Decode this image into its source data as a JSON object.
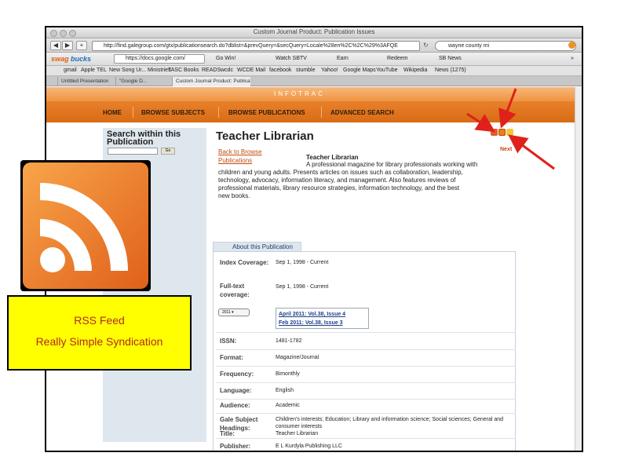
{
  "window": {
    "title": "Custom Journal Product: Publication Issues"
  },
  "toolbar": {
    "url": "http://find.galegroup.com/gtx/publicationsearch.do?dblist=&prevQuery=&secQuery=Locale%28en%2C%2C%29%3AFQE",
    "search_value": "wayne county mi"
  },
  "swagbar": {
    "logo_swag": "swag",
    "logo_bucks": "bucks",
    "search_value": "https://docs.google.com/",
    "items": [
      "Go Win!",
      "Watch SBTV",
      "Earn",
      "Redeem",
      "SB News"
    ],
    "overflow": "»"
  },
  "bookmarks": {
    "items": [
      "gmail",
      "Apple",
      "TEL",
      "New Song Ur... Ministries",
      "TASC",
      "Books",
      "READS",
      "wcdc",
      "WCDE Mail",
      "facebook",
      "stumble",
      "Yahoo!",
      "Google Maps",
      "YouTube",
      "Wikipedia",
      "News (1275)"
    ]
  },
  "tabs": {
    "items": [
      "Untitled Presentation",
      "\"Google D...",
      "Custom Journal Product: Publicati..."
    ]
  },
  "site": {
    "logo": "INFOTRAC",
    "nav": [
      "HOME",
      "BROWSE SUBJECTS",
      "BROWSE PUBLICATIONS",
      "ADVANCED SEARCH"
    ]
  },
  "sidebar": {
    "heading": "Search within this Publication",
    "go_label": "Go"
  },
  "publication": {
    "title": "Teacher Librarian",
    "back_link": "Back to Browse Publications",
    "next_label": "Next",
    "desc_title": "Teacher Librarian",
    "desc_lines": [
      "A professional magazine for library professionals working with",
      "children and young adults. Presents articles on issues such as collaboration, leadership,",
      "technology, advocacy, information literacy, and management. Also features reviews of",
      "professional materials, library resource strategies, information technology, and the best",
      "new books."
    ],
    "about_tab": "About this Publication",
    "year_select": "2011",
    "issues": [
      "April 2011: Vol.38, Issue 4",
      "Feb 2011: Vol.38, Issue 3"
    ],
    "fields": [
      {
        "label": "Index Coverage:",
        "value": "Sep 1, 1998 - Current"
      },
      {
        "label": "Full-text coverage:",
        "value": "Sep 1, 1998 - Current"
      },
      {
        "label": "ISSN:",
        "value": "1481-1782"
      },
      {
        "label": "Format:",
        "value": "Magazine/Journal"
      },
      {
        "label": "Frequency:",
        "value": "Bimonthly"
      },
      {
        "label": "Language:",
        "value": "English"
      },
      {
        "label": "Audience:",
        "value": "Academic"
      },
      {
        "label": "Gale Subject Headings:",
        "value": "Children's interests; Education; Library and information science; Social sciences; General and consumer interests"
      },
      {
        "label": "Publisher:",
        "value": "E L Kurdyla Publishing LLC"
      },
      {
        "label": "Title:",
        "value": "Teacher Librarian"
      }
    ]
  },
  "overlay": {
    "rss_line1": "RSS Feed",
    "rss_line2": "Really Simple Syndication"
  },
  "colors": {
    "nav_orange": "#d96c15",
    "rss_orange": "#f07c1a",
    "arrow_red": "#e0201a",
    "label_yellow": "#ffff00",
    "label_text": "#b22a22"
  }
}
